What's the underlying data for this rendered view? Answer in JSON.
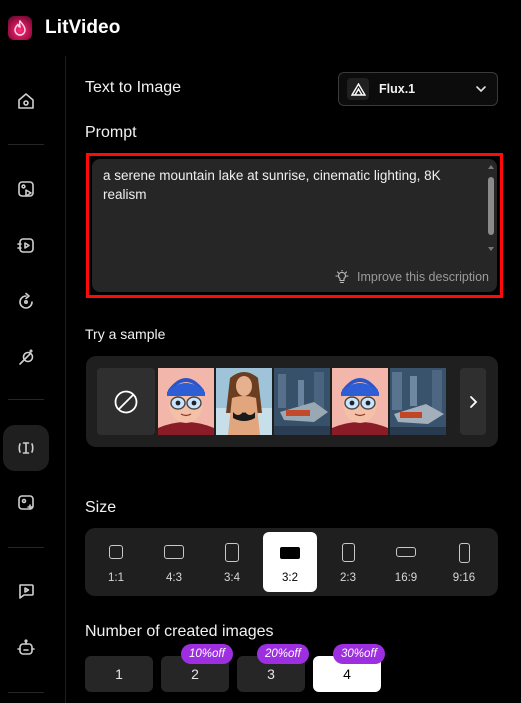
{
  "app": {
    "title": "LitVideo",
    "accent": "#e8195f"
  },
  "sidebar": {
    "items": [
      {
        "name": "home",
        "icon": "home-icon"
      },
      {
        "name": "image-to-video",
        "icon": "image-video-icon"
      },
      {
        "name": "text-to-video",
        "icon": "text-video-icon"
      },
      {
        "name": "history",
        "icon": "refresh-icon"
      },
      {
        "name": "magic",
        "icon": "magic-icon"
      },
      {
        "name": "text-to-image",
        "icon": "text-cursor-icon",
        "active": true
      },
      {
        "name": "image-edit",
        "icon": "image-sparkle-icon"
      },
      {
        "name": "video-chat",
        "icon": "video-chat-icon"
      },
      {
        "name": "ai-bot",
        "icon": "robot-icon"
      }
    ]
  },
  "main": {
    "title": "Text to Image",
    "model": {
      "label": "Flux.1",
      "icon": "flux-logo-icon"
    },
    "prompt": {
      "label": "Prompt",
      "value": "a serene mountain lake at sunrise, cinematic lighting, 8K realism",
      "improve_label": "Improve this description",
      "highlight_color": "#ff0a0a"
    },
    "samples": {
      "label": "Try a sample",
      "items": [
        "none",
        "cartoon-boy",
        "woman-portrait",
        "spaceship",
        "cartoon-boy",
        "spaceship"
      ]
    },
    "size": {
      "label": "Size",
      "options": [
        "1:1",
        "4:3",
        "3:4",
        "3:2",
        "2:3",
        "16:9",
        "9:16"
      ],
      "selected": "3:2"
    },
    "count": {
      "label": "Number of created images",
      "options": [
        {
          "value": "1",
          "discount": ""
        },
        {
          "value": "2",
          "discount": "10%off"
        },
        {
          "value": "3",
          "discount": "20%off"
        },
        {
          "value": "4",
          "discount": "30%off"
        }
      ],
      "selected": "4",
      "discount_color": "#9d2fe0"
    }
  }
}
